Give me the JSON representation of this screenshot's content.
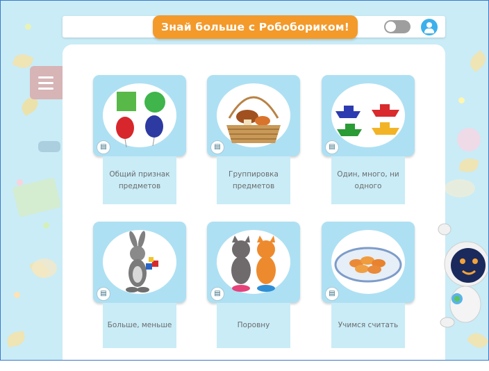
{
  "header": {
    "banner_text": "Знай больше с Робобориком!"
  },
  "lessons": [
    {
      "title": "Общий признак предметов",
      "image": "shapes-and-balloons"
    },
    {
      "title": "Группировка предметов",
      "image": "mushroom-basket"
    },
    {
      "title": "Один, много, ни одного",
      "image": "toy-boats"
    },
    {
      "title": "Больше, меньше",
      "image": "rabbit-with-cubes"
    },
    {
      "title": "Поровну",
      "image": "two-cats-with-bowls"
    },
    {
      "title": "Учимся считать",
      "image": "plate-of-food"
    }
  ],
  "icons": {
    "menu": "hamburger-menu-icon",
    "toggle": "theme-toggle",
    "profile": "user-profile-icon",
    "doc": "document-icon"
  },
  "colors": {
    "banner": "#f39a2b",
    "background": "#c9ecf7",
    "tile": "#aee0f3",
    "menu": "#d7b4b6",
    "profile": "#3cb0ec"
  }
}
